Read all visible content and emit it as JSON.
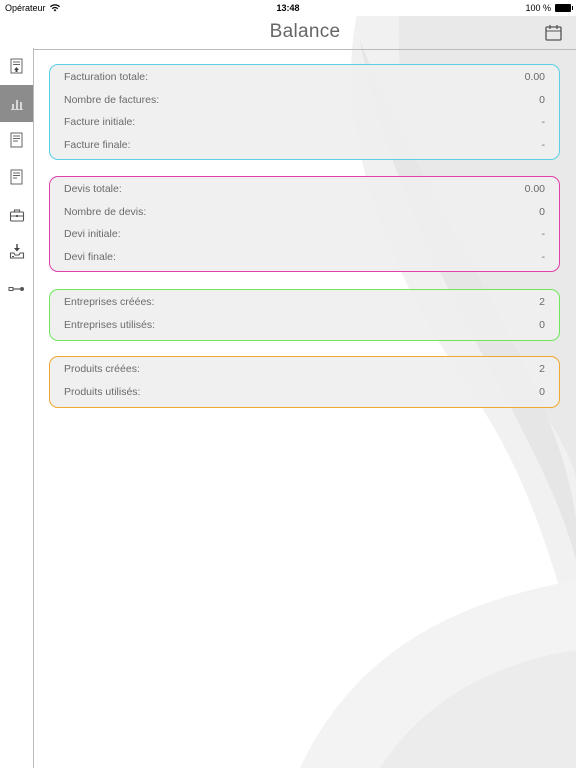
{
  "status_bar": {
    "carrier": "Opérateur",
    "time": "13:48",
    "battery": "100 %"
  },
  "nav": {
    "title": "Balance",
    "calendar_icon": "calendar-icon"
  },
  "sidebar": {
    "items": [
      {
        "icon": "invoice-upload-icon",
        "active": false
      },
      {
        "icon": "bar-chart-icon",
        "active": true
      },
      {
        "icon": "invoice-icon",
        "active": false
      },
      {
        "icon": "quote-icon",
        "active": false
      },
      {
        "icon": "briefcase-icon",
        "active": false
      },
      {
        "icon": "inbox-download-icon",
        "active": false
      },
      {
        "icon": "key-icon",
        "active": false
      }
    ]
  },
  "invoices": {
    "color": "#5ccfe6",
    "rows": [
      {
        "label": "Facturation totale:",
        "value": "0.00"
      },
      {
        "label": "Nombre de factures:",
        "value": "0"
      },
      {
        "label": "Facture initiale:",
        "value": "-"
      },
      {
        "label": "Facture finale:",
        "value": "-"
      }
    ]
  },
  "quotes": {
    "color": "#e040a8",
    "rows": [
      {
        "label": "Devis totale:",
        "value": "0.00"
      },
      {
        "label": "Nombre de devis:",
        "value": "0"
      },
      {
        "label": "Devi initiale:",
        "value": "-"
      },
      {
        "label": "Devi finale:",
        "value": "-"
      }
    ]
  },
  "companies": {
    "color": "#6ee85a",
    "rows": [
      {
        "label": "Entreprises créées:",
        "value": "2"
      },
      {
        "label": "Entreprises utilisés:",
        "value": "0"
      }
    ]
  },
  "products": {
    "color": "#f0a830",
    "rows": [
      {
        "label": "Produits créées:",
        "value": "2"
      },
      {
        "label": "Produits utilisés:",
        "value": "0"
      }
    ]
  }
}
